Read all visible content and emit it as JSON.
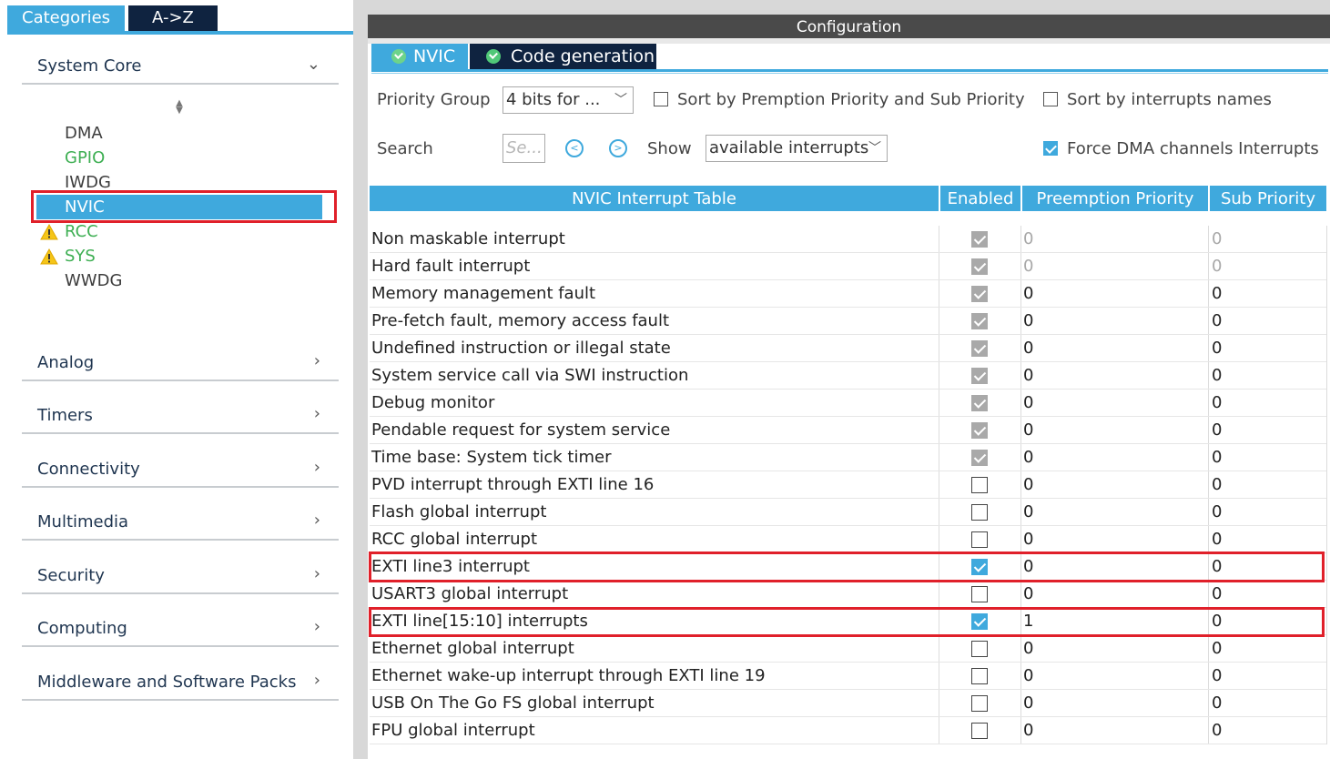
{
  "left": {
    "tabs": {
      "categories": "Categories",
      "az": "A->Z"
    },
    "categories": [
      {
        "label": "System Core",
        "chevron": "⌄"
      },
      {
        "label": "Analog",
        "chevron": "›"
      },
      {
        "label": "Timers",
        "chevron": "›"
      },
      {
        "label": "Connectivity",
        "chevron": "›"
      },
      {
        "label": "Multimedia",
        "chevron": "›"
      },
      {
        "label": "Security",
        "chevron": "›"
      },
      {
        "label": "Computing",
        "chevron": "›"
      },
      {
        "label": "Middleware and Software Packs",
        "chevron": "›"
      }
    ],
    "core_items": {
      "dma": "DMA",
      "gpio": "GPIO",
      "iwdg": "IWDG",
      "nvic": "NVIC",
      "rcc": "RCC",
      "sys": "SYS",
      "wwdg": "WWDG"
    }
  },
  "config": {
    "header": "Configuration",
    "tabs": {
      "nvic": "NVIC",
      "code": "Code generation"
    },
    "priority_group_label": "Priority Group",
    "priority_group_value": "4 bits for ...",
    "sort_premption_label": "Sort by Premption Priority and Sub Priority",
    "sort_names_label": "Sort by interrupts names",
    "search_label": "Search",
    "search_placeholder": "Se...",
    "show_label": "Show",
    "show_value": "available interrupts",
    "force_dma_label": "Force DMA channels Interrupts",
    "table": {
      "headers": {
        "name": "NVIC Interrupt Table",
        "enabled": "Enabled",
        "preemption": "Preemption Priority",
        "sub": "Sub Priority"
      },
      "rows": [
        {
          "name": "Non maskable interrupt",
          "pre": "0",
          "sub": "0"
        },
        {
          "name": "Hard fault interrupt",
          "pre": "0",
          "sub": "0"
        },
        {
          "name": "Memory management fault",
          "pre": "0",
          "sub": "0"
        },
        {
          "name": "Pre-fetch fault, memory access fault",
          "pre": "0",
          "sub": "0"
        },
        {
          "name": "Undefined instruction or illegal state",
          "pre": "0",
          "sub": "0"
        },
        {
          "name": "System service call via SWI instruction",
          "pre": "0",
          "sub": "0"
        },
        {
          "name": "Debug monitor",
          "pre": "0",
          "sub": "0"
        },
        {
          "name": "Pendable request for system service",
          "pre": "0",
          "sub": "0"
        },
        {
          "name": "Time base: System tick timer",
          "pre": "0",
          "sub": "0"
        },
        {
          "name": "PVD interrupt through EXTI line 16",
          "pre": "0",
          "sub": "0"
        },
        {
          "name": "Flash global interrupt",
          "pre": "0",
          "sub": "0"
        },
        {
          "name": "RCC global interrupt",
          "pre": "0",
          "sub": "0"
        },
        {
          "name": "EXTI line3 interrupt",
          "pre": "0",
          "sub": "0"
        },
        {
          "name": "USART3 global interrupt",
          "pre": "0",
          "sub": "0"
        },
        {
          "name": "EXTI line[15:10] interrupts",
          "pre": "1",
          "sub": "0"
        },
        {
          "name": "Ethernet global interrupt",
          "pre": "0",
          "sub": "0"
        },
        {
          "name": "Ethernet wake-up interrupt through EXTI line 19",
          "pre": "0",
          "sub": "0"
        },
        {
          "name": "USB On The Go FS global interrupt",
          "pre": "0",
          "sub": "0"
        },
        {
          "name": "FPU global interrupt",
          "pre": "0",
          "sub": "0"
        }
      ]
    }
  }
}
